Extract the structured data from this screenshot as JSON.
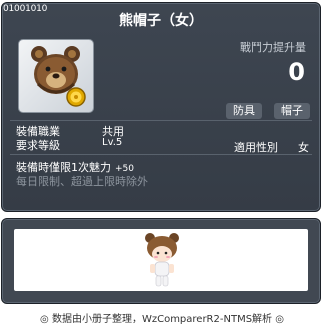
{
  "item": {
    "id": "01001010",
    "name": "熊帽子（女）",
    "icon": "bear-hat-icon",
    "stat_label": "戰鬥力提升量",
    "stat_value": "0",
    "tags": [
      "防具",
      "帽子"
    ],
    "job_label": "裝備職業",
    "job_value": "共用",
    "level_label": "要求等級",
    "level_value": "Lv.5",
    "gender_label": "適用性別",
    "gender_value": "女",
    "equip_note": "裝備時僅限1次魅力",
    "equip_bonus": "+50",
    "limit_note": "每日限制、超過上限時除外"
  },
  "preview": {
    "character_icon": "character-preview-icon"
  },
  "footer": {
    "text": "◎ 数据由小册子整理，WzComparerR2-NTMS解析 ◎"
  },
  "colors": {
    "panel_bg": "#3a414b",
    "tag_bg": "#5a626d",
    "muted_text": "#8d959e",
    "coin": "#f5c400"
  }
}
